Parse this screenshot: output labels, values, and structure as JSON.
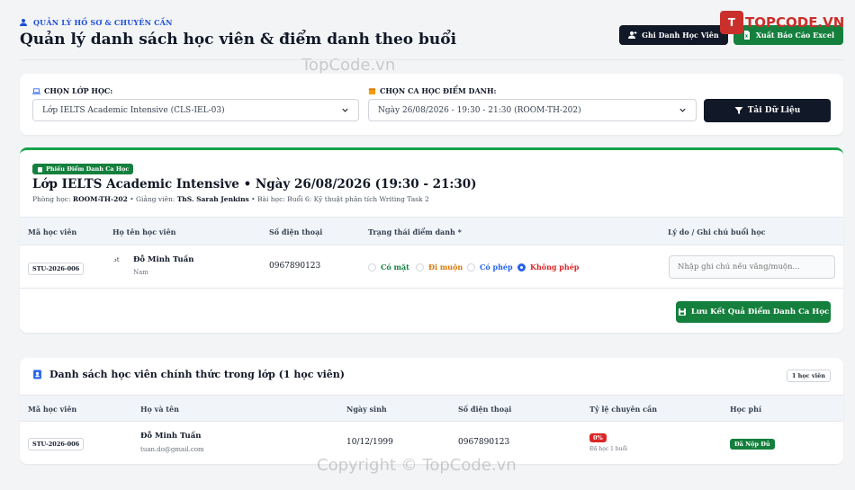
{
  "header": {
    "eyebrow": "QUẢN LÝ HỒ SƠ & CHUYÊN CẦN",
    "title": "Quản lý danh sách học viên & điểm danh theo buổi",
    "btn_register": "Ghi Danh Học Viên",
    "btn_export": "Xuất Báo Cáo Excel"
  },
  "branding": {
    "logo_mark": "T",
    "logo_text": "TOPCODE.VN",
    "watermark_top": "TopCode.vn",
    "watermark_bottom": "Copyright © TopCode.vn"
  },
  "filters": {
    "class_label": "CHỌN LỚP HỌC:",
    "class_value": "Lớp IELTS Academic Intensive (CLS-IEL-03)",
    "session_label": "CHỌN CA HỌC ĐIỂM DANH:",
    "session_value": "Ngày 26/08/2026 - 19:30 - 21:30 (ROOM-TH-202)",
    "reload_label": "Tải Dữ Liệu"
  },
  "attendance": {
    "badge": "Phiếu Điểm Danh Ca Học",
    "title": "Lớp IELTS Academic Intensive • Ngày 26/08/2026 (19:30 - 21:30)",
    "room_label": "Phòng học:",
    "room": "ROOM-TH-202",
    "teacher_label": "• Giảng viên:",
    "teacher": "ThS. Sarah Jenkins",
    "lesson": "• Bài học: Buổi 6: Kỹ thuật phân tích Writing Task 2",
    "columns": {
      "code": "Mã học viên",
      "name": "Họ tên học viên",
      "phone": "Số điện thoại",
      "status": "Trạng thái điểm danh *",
      "note": "Lý do / Ghi chú buổi học"
    },
    "row": {
      "code": "STU-2026-006",
      "avatar_alt": "St",
      "name": "Đỗ Minh Tuấn",
      "gender": "Nam",
      "phone": "0967890123",
      "opt_present": "Có mặt",
      "opt_late": "Đi muộn",
      "opt_excused": "Có phép",
      "opt_absent": "Không phép",
      "note_placeholder": "Nhập ghi chú nếu vắng/muộn..."
    },
    "save_label": "Lưu Kết Quả Điểm Danh Ca Học"
  },
  "roster": {
    "title": "Danh sách học viên chính thức trong lớp (1 học viên)",
    "count": "1 học viên",
    "columns": {
      "code": "Mã học viên",
      "name": "Họ và tên",
      "dob": "Ngày sinh",
      "phone": "Số điện thoại",
      "rate": "Tỷ lệ chuyên cần",
      "fee": "Học phí"
    },
    "row": {
      "code": "STU-2026-006",
      "name": "Đỗ Minh Tuấn",
      "email": "tuan.do@gmail.com",
      "dob": "10/12/1999",
      "phone": "0967890123",
      "rate": "0%",
      "rate_note": "Đã học 1 buổi",
      "fee": "Đã Nộp Đủ"
    }
  },
  "colors": {
    "accent_blue": "#1d4ed8",
    "dark": "#111827",
    "green": "#15803d",
    "red": "#dc2626"
  }
}
